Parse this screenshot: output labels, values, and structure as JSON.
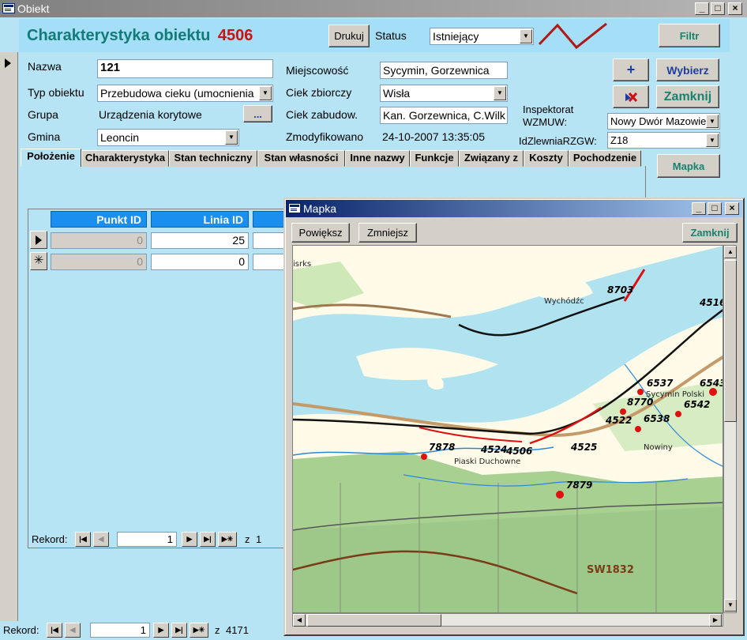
{
  "window": {
    "title": "Obiekt"
  },
  "header": {
    "title": "Charakterystyka obiektu",
    "object_id": "4506",
    "print_label": "Drukuj",
    "status_label": "Status",
    "status_value": "Istniejący",
    "filter_label": "Filtr"
  },
  "fields": {
    "nazwa_label": "Nazwa",
    "nazwa_value": "121",
    "typ_label": "Typ obiektu",
    "typ_value": "Przebudowa cieku (umocnienia",
    "grupa_label": "Grupa",
    "grupa_value": "Urządzenia korytowe",
    "grupa_button": "...",
    "gmina_label": "Gmina",
    "gmina_value": "Leoncin",
    "miejscowosc_label": "Miejscowość",
    "miejscowosc_value": "Sycymin, Gorzewnica",
    "ciek_zbiorczy_label": "Ciek zbiorczy",
    "ciek_zbiorczy_value": "Wisła",
    "ciek_zabudow_label": "Ciek zabudow.",
    "ciek_zabudow_value": "Kan. Gorzewnica, C.Wilk",
    "zmodyfikowano_label": "Zmodyfikowano",
    "zmodyfikowano_value": "24-10-2007 13:35:05",
    "inspektorat_label_1": "Inspektorat",
    "inspektorat_label_2": "WZMUW:",
    "inspektorat_value": "Nowy Dwór Mazowie",
    "idzlewnia_label": "IdZlewniaRZGW:",
    "idzlewnia_value": "Z18"
  },
  "actions": {
    "add_symbol": "+",
    "choose_label": "Wybierz",
    "close_label": "Zamknij",
    "map_label": "Mapka"
  },
  "tabs": [
    "Położenie",
    "Charakterystyka",
    "Stan techniczny",
    "Stan własności",
    "Inne nazwy",
    "Funkcje",
    "Związany z",
    "Koszty",
    "Pochodzenie"
  ],
  "subform": {
    "columns": [
      "Punkt ID",
      "Linia ID"
    ],
    "rows": [
      {
        "punkt": "0",
        "linia": "25"
      },
      {
        "punkt": "0",
        "linia": "0"
      }
    ],
    "nav": {
      "label": "Rekord:",
      "current": "1",
      "of": "z",
      "total": "1"
    }
  },
  "main_nav": {
    "label": "Rekord:",
    "current": "1",
    "of": "z",
    "total": "4171"
  },
  "mapka": {
    "title": "Mapka",
    "zoom_in": "Powiększ",
    "zoom_out": "Zmniejsz",
    "close": "Zamknij",
    "labels": {
      "p8703": "8703",
      "p4516": "4516",
      "p6537": "6537",
      "p6543": "6543",
      "p8770": "8770",
      "p6542": "6542",
      "p4522": "4522",
      "p6538": "6538",
      "p7878": "7878",
      "p4524": "4524",
      "p4506": "4506",
      "p4525": "4525",
      "p7879": "7879",
      "road": "SW1832"
    },
    "places": {
      "wychodzc": "Wychódźc",
      "sycymin": "Sycymin Polski",
      "nowiny": "Nowiny",
      "piaski": "Piaski Duchowne",
      "isrks": "isrks"
    },
    "colors": {
      "river": "#b0e2f0",
      "forest": "#9dc88a",
      "object_line": "#e01010"
    }
  }
}
